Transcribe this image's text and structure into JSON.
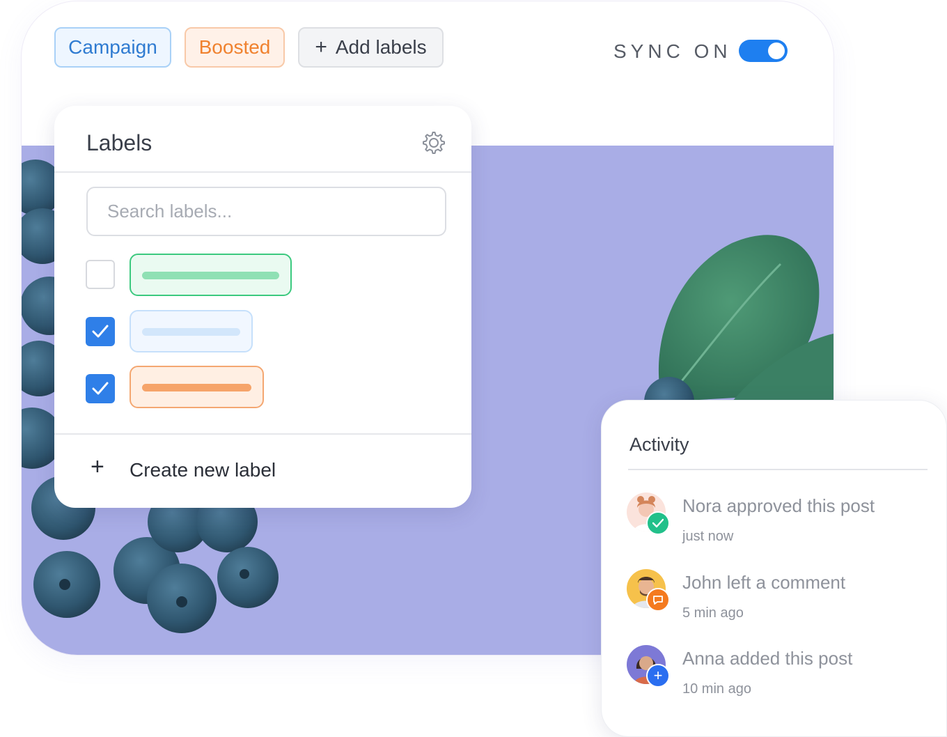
{
  "header": {
    "chips": [
      {
        "label": "Campaign"
      },
      {
        "label": "Boosted"
      },
      {
        "label": "Add labels",
        "icon": "plus-icon"
      }
    ],
    "sync_label": "SYNC ON",
    "sync_on": true
  },
  "labels_panel": {
    "title": "Labels",
    "settings_icon": "gear-icon",
    "search_placeholder": "Search labels...",
    "items": [
      {
        "checked": false,
        "color": "#2ecc71"
      },
      {
        "checked": true,
        "color": "#a9d1f7"
      },
      {
        "checked": true,
        "color": "#f6a46a"
      }
    ],
    "create_label": "Create new label"
  },
  "activity": {
    "title": "Activity",
    "items": [
      {
        "message": "Nora approved this post",
        "time": "just now",
        "badge": "check-icon",
        "badge_color": "#22c08a"
      },
      {
        "message": "John left a comment",
        "time": "5 min ago",
        "badge": "comment-icon",
        "badge_color": "#f47a1f"
      },
      {
        "message": "Anna added this post",
        "time": "10 min ago",
        "badge": "plus-icon",
        "badge_color": "#2a6ef0"
      }
    ]
  },
  "colors": {
    "accent_blue": "#1e7ff0",
    "campaign": "#2f7bd1",
    "boosted": "#f0822f",
    "photo_background": "#a9ade6"
  }
}
